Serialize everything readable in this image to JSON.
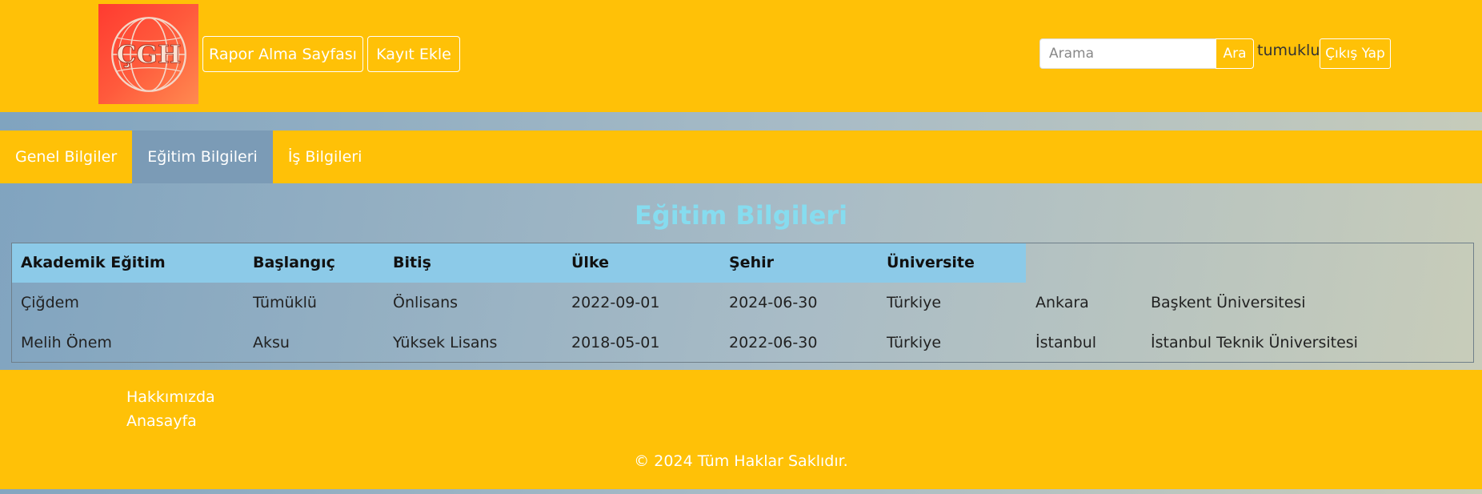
{
  "header": {
    "logo_text": "ÇGH",
    "nav_buttons": [
      {
        "label": "Rapor Alma Sayfası"
      },
      {
        "label": "Kayıt Ekle"
      }
    ],
    "search": {
      "placeholder": "Arama",
      "button_label": "Ara"
    },
    "username": "tumuklu",
    "logout_label": "Çıkış Yap"
  },
  "tabs": [
    {
      "label": "Genel Bilgiler",
      "active": false
    },
    {
      "label": "Eğitim Bilgileri",
      "active": true
    },
    {
      "label": "İş Bilgileri",
      "active": false
    }
  ],
  "main": {
    "title": "Eğitim Bilgileri",
    "table": {
      "headers": [
        "Akademik Eğitim",
        "Başlangıç",
        "Bitiş",
        "Ülke",
        "Şehir",
        "Üniversite"
      ],
      "rows": [
        [
          "Çiğdem",
          "Tümüklü",
          "Önlisans",
          "2022-09-01",
          "2024-06-30",
          "Türkiye",
          "Ankara",
          "Başkent Üniversitesi"
        ],
        [
          "Melih Önem",
          "Aksu",
          "Yüksek Lisans",
          "2018-05-01",
          "2022-06-30",
          "Türkiye",
          "İstanbul",
          "İstanbul Teknik Üniversitesi"
        ]
      ]
    }
  },
  "footer": {
    "links": [
      "Hakkımızda",
      "Anasayfa"
    ],
    "copyright": "© 2024 Tüm Haklar Saklıdır."
  },
  "colors": {
    "header_bg": "#ffc107",
    "active_tab_bg": "#7b9bb6",
    "title_color": "#86dcef",
    "table_header_bg": "#8ccae8"
  }
}
